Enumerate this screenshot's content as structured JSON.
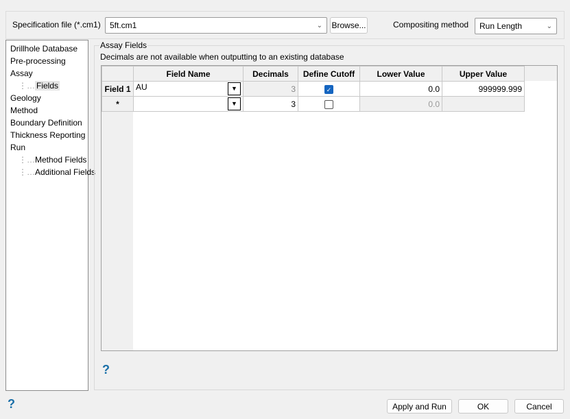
{
  "top": {
    "spec_label": "Specification file (*.cm1)",
    "spec_value": "5ft.cm1",
    "browse": "Browse...",
    "method_label": "Compositing method",
    "method_value": "Run Length"
  },
  "tree": [
    "Drillhole Database",
    "Pre-processing",
    "Assay",
    "Fields",
    "Geology",
    "Method",
    "Boundary Definition",
    "Thickness Reporting",
    "Run",
    "Method Fields",
    "Additional Fields"
  ],
  "group": {
    "title": "Assay Fields",
    "note": "Decimals are not available when outputting to an existing database"
  },
  "grid": {
    "headers": [
      "Field Name",
      "Decimals",
      "Define Cutoff",
      "Lower Value",
      "Upper Value"
    ],
    "rows": [
      {
        "header": "Field 1",
        "field": "AU",
        "decimals": "3",
        "cutoff": true,
        "lower": "0.0",
        "upper": "999999.999"
      },
      {
        "header": "*",
        "field": "",
        "decimals": "3",
        "cutoff": false,
        "lower": "0.0",
        "upper": ""
      }
    ]
  },
  "buttons": {
    "apply": "Apply and Run",
    "ok": "OK",
    "cancel": "Cancel"
  },
  "help": "?"
}
